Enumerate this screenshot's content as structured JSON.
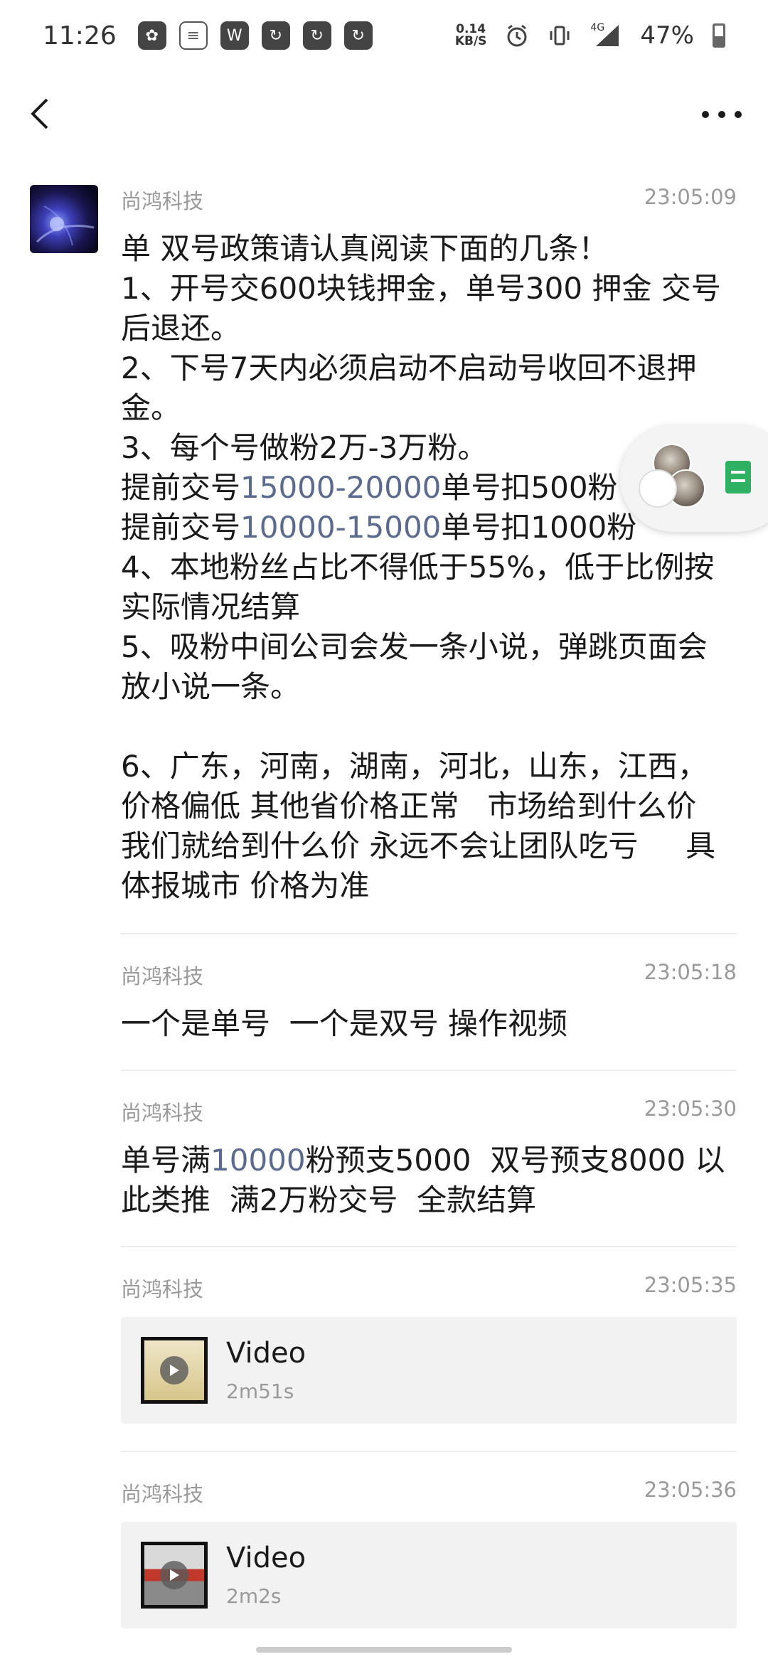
{
  "status_bar": {
    "time": "11:26",
    "net_speed_value": "0.14",
    "net_speed_unit": "KB/S",
    "network": "4G",
    "battery": "47%",
    "app_icons": [
      "bee-icon",
      "document-icon",
      "wps-icon",
      "refresh-icon",
      "refresh-icon",
      "refresh-icon"
    ]
  },
  "nav": {
    "back_icon": "chevron-left-icon",
    "more_icon": "more-dots-icon"
  },
  "messages": [
    {
      "sender": "尚鸿科技",
      "time": "23:05:09",
      "lines": [
        "单 双号政策请认真阅读下面的几条！",
        "1、开号交600块钱押金，单号300 押金 交号后退还。",
        "2、下号7天内必须启动不启动号收回不退押金。",
        "3、每个号做粉2万-3万粉。",
        {
          "pre": "提前交号",
          "link": "15000-20000",
          "post": "单号扣500粉"
        },
        {
          "pre": "提前交号",
          "link": "10000-15000",
          "post": "单号扣1000粉"
        },
        "4、本地粉丝占比不得低于55%，低于比例按实际情况结算",
        "5、吸粉中间公司会发一条小说，弹跳页面会放小说一条。",
        "",
        "6、广东，河南，湖南，河北，山东，江西，价格偏低 其他省价格正常   市场给到什么价  我们就给到什么价 永远不会让团队吃亏     具体报城市 价格为准"
      ]
    },
    {
      "sender": "尚鸿科技",
      "time": "23:05:18",
      "text": "一个是单号  一个是双号 操作视频"
    },
    {
      "sender": "尚鸿科技",
      "time": "23:05:30",
      "pre": "单号满",
      "link": "10000",
      "post": "粉预支5000  双号预支8000 以此类推  满2万粉交号  全款结算"
    },
    {
      "sender": "尚鸿科技",
      "time": "23:05:35",
      "video_title": "Video",
      "video_duration": "2m51s"
    },
    {
      "sender": "尚鸿科技",
      "time": "23:05:36",
      "video_title": "Video",
      "video_duration": "2m2s"
    }
  ],
  "colors": {
    "link": "#5b6b8f",
    "meta": "#9a9a9a",
    "card_bg": "#f2f2f2"
  }
}
